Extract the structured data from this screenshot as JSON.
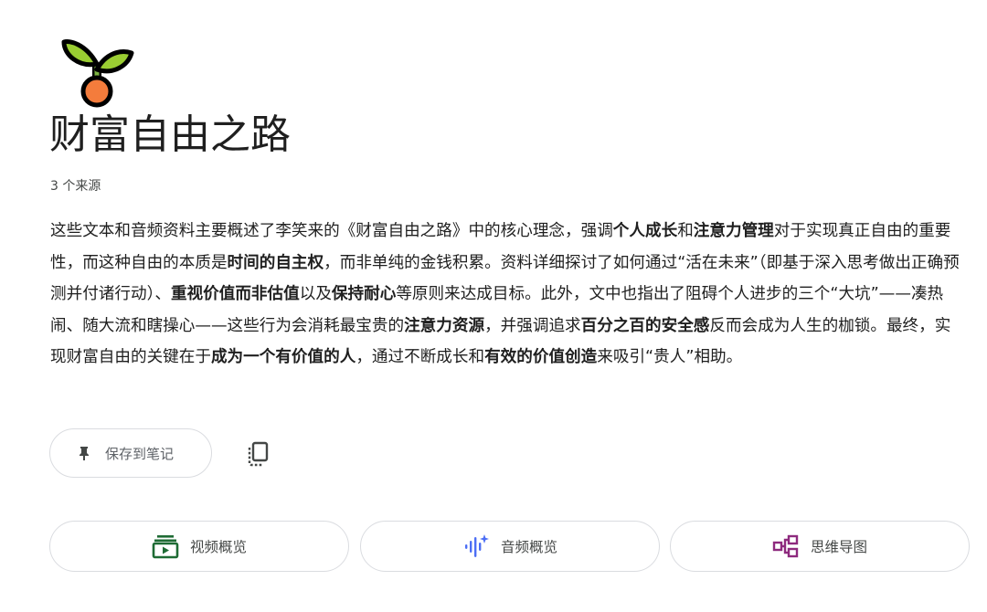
{
  "notebook": {
    "title": "财富自由之路",
    "source_count": "3 个来源"
  },
  "summary": [
    {
      "text": "这些文本和音频资料主要概述了李笑来的《财富自由之路》中的核心理念，强调",
      "bold": false
    },
    {
      "text": "个人成长",
      "bold": true
    },
    {
      "text": "和",
      "bold": false
    },
    {
      "text": "注意力管理",
      "bold": true
    },
    {
      "text": "对于实现真正自由的重要性，而这种自由的本质是",
      "bold": false
    },
    {
      "text": "时间的自主权",
      "bold": true
    },
    {
      "text": "，而非单纯的金钱积累。资料详细探讨了如何通过“活在未来”（即基于深入思考做出正确预测并付诸行动）、",
      "bold": false
    },
    {
      "text": "重视价值而非估值",
      "bold": true
    },
    {
      "text": "以及",
      "bold": false
    },
    {
      "text": "保持耐心",
      "bold": true
    },
    {
      "text": "等原则来达成目标。此外，文中也指出了阻碍个人进步的三个“大坑”——凑热闹、随大流和瞎操心——这些行为会消耗最宝贵的",
      "bold": false
    },
    {
      "text": "注意力资源",
      "bold": true
    },
    {
      "text": "，并强调追求",
      "bold": false
    },
    {
      "text": "百分之百的安全感",
      "bold": true
    },
    {
      "text": "反而会成为人生的枷锁。最终，实现财富自由的关键在于",
      "bold": false
    },
    {
      "text": "成为一个有价值的人",
      "bold": true
    },
    {
      "text": "，通过不断成长和",
      "bold": false
    },
    {
      "text": "有效的价值创造",
      "bold": true
    },
    {
      "text": "来吸引“贵人”相助。",
      "bold": false
    }
  ],
  "actions": {
    "save_label": "保存到笔记",
    "save_icon": "pin-icon",
    "copy_icon": "copy-icon"
  },
  "overviews": {
    "video": {
      "label": "视频概览",
      "icon": "video-overview-icon",
      "color": "#1e6b34"
    },
    "audio": {
      "label": "音频概览",
      "icon": "audio-overview-icon",
      "color": "#4c6ef5"
    },
    "mindmap": {
      "label": "思维导图",
      "icon": "mind-map-icon",
      "color": "#8e2a7e"
    }
  },
  "colors": {
    "logo_leaf": "#9acd32",
    "logo_seed": "#f47c3c",
    "text": "#1f1f1f",
    "muted": "#5f6368",
    "border": "#dadce0"
  }
}
